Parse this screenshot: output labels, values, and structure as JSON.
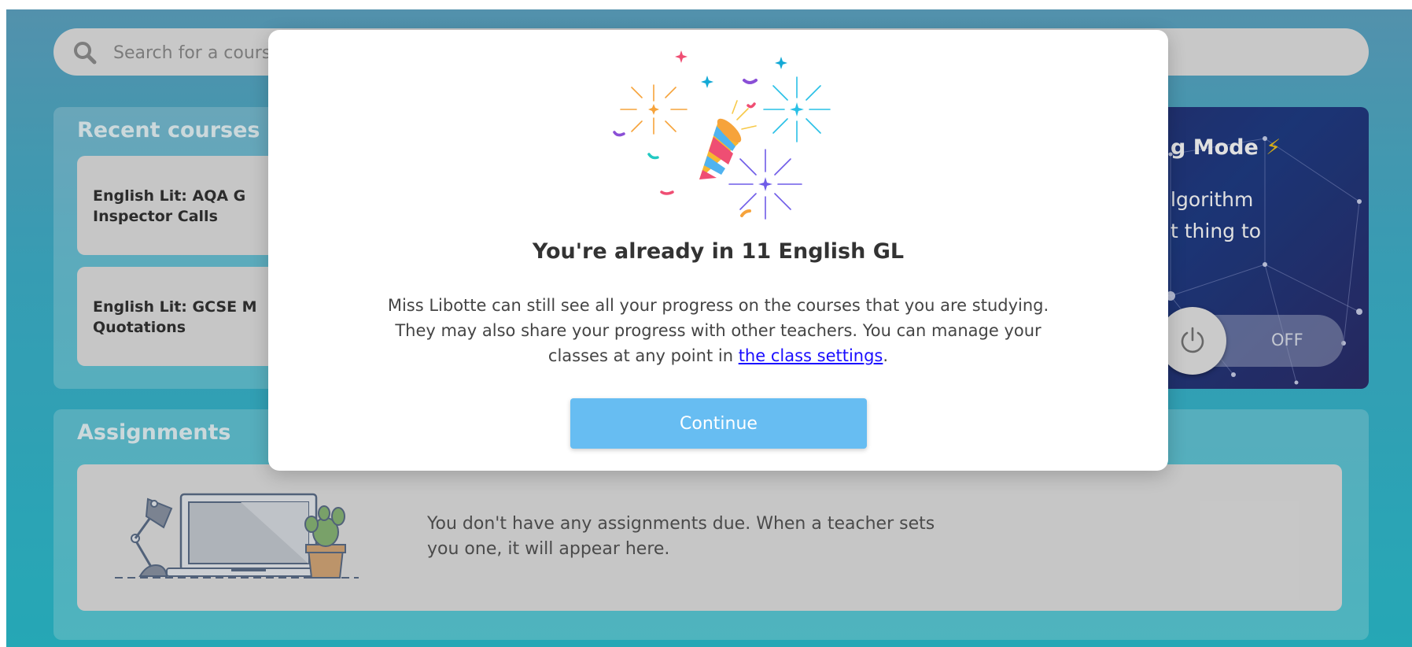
{
  "search": {
    "placeholder": "Search for a course"
  },
  "recent": {
    "title": "Recent courses",
    "courses": [
      {
        "line1": "English Lit: AQA G",
        "line2": "Inspector Calls"
      },
      {
        "line1": "English Lit: GCSE M",
        "line2": "Quotations"
      }
    ]
  },
  "learning_mode": {
    "title": "g Mode",
    "bolt": "⚡",
    "desc_line1": "lgorithm",
    "desc_line2": "t thing to",
    "toggle_state": "OFF"
  },
  "assignments": {
    "title": "Assignments",
    "empty_line1": "You don't have any assignments due. When a teacher sets",
    "empty_line2": "you one, it will appear here."
  },
  "modal": {
    "title": "You're already in 11 English GL",
    "body_text": "Miss Libotte can still see all your progress on the courses that you are studying. They may also share your progress with other teachers. You can manage your classes at any point in ",
    "link_text": "the class settings",
    "body_suffix": ".",
    "button_label": "Continue"
  }
}
